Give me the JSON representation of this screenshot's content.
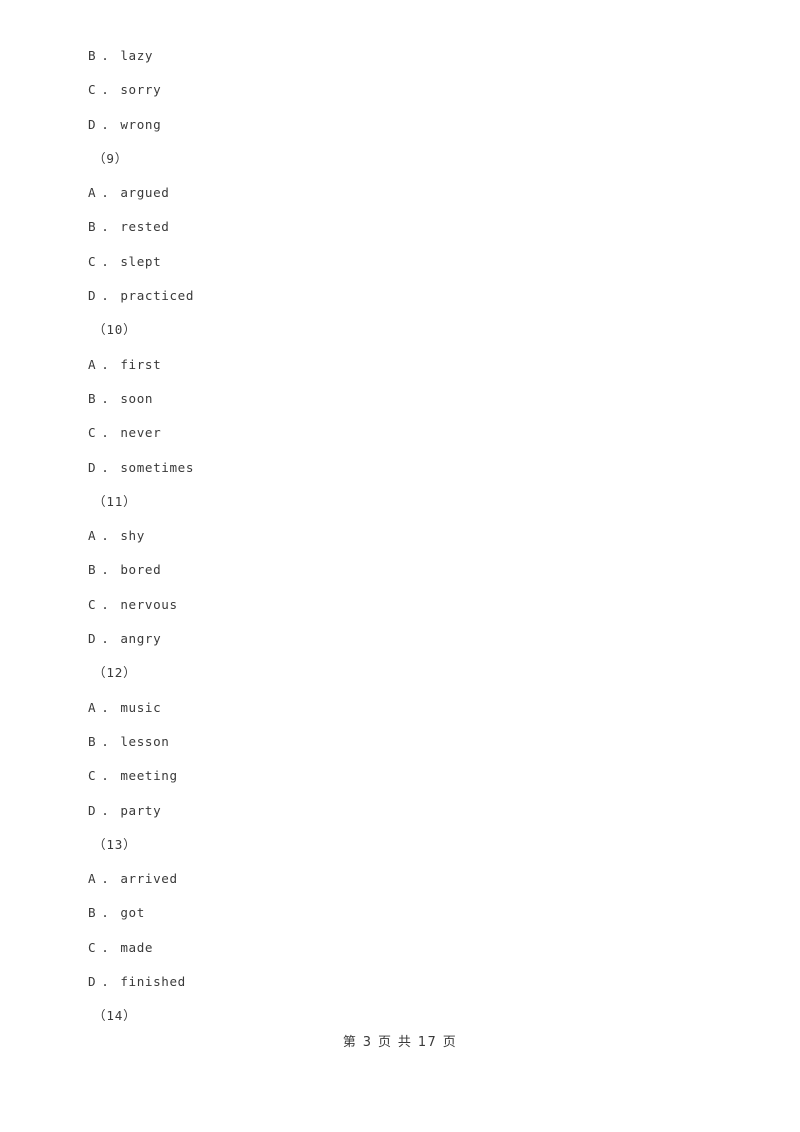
{
  "document": {
    "footer": {
      "page_label": "第 3 页 共 17 页"
    },
    "lines": [
      {
        "kind": "option",
        "label": "B",
        "sep": ".",
        "text": "lazy"
      },
      {
        "kind": "option",
        "label": "C",
        "sep": ".",
        "text": "sorry"
      },
      {
        "kind": "option",
        "label": "D",
        "sep": ".",
        "text": "wrong"
      },
      {
        "kind": "qnum",
        "text": "（9）"
      },
      {
        "kind": "option",
        "label": "A",
        "sep": ".",
        "text": "argued"
      },
      {
        "kind": "option",
        "label": "B",
        "sep": ".",
        "text": "rested"
      },
      {
        "kind": "option",
        "label": "C",
        "sep": ".",
        "text": "slept"
      },
      {
        "kind": "option",
        "label": "D",
        "sep": ".",
        "text": "practiced"
      },
      {
        "kind": "qnum",
        "text": "（10）"
      },
      {
        "kind": "option",
        "label": "A",
        "sep": ".",
        "text": "first"
      },
      {
        "kind": "option",
        "label": "B",
        "sep": ".",
        "text": "soon"
      },
      {
        "kind": "option",
        "label": "C",
        "sep": ".",
        "text": "never"
      },
      {
        "kind": "option",
        "label": "D",
        "sep": ".",
        "text": "sometimes"
      },
      {
        "kind": "qnum",
        "text": "（11）"
      },
      {
        "kind": "option",
        "label": "A",
        "sep": ".",
        "text": "shy"
      },
      {
        "kind": "option",
        "label": "B",
        "sep": ".",
        "text": "bored"
      },
      {
        "kind": "option",
        "label": "C",
        "sep": ".",
        "text": "nervous"
      },
      {
        "kind": "option",
        "label": "D",
        "sep": ".",
        "text": "angry"
      },
      {
        "kind": "qnum",
        "text": "（12）"
      },
      {
        "kind": "option",
        "label": "A",
        "sep": ".",
        "text": "music"
      },
      {
        "kind": "option",
        "label": "B",
        "sep": ".",
        "text": "lesson"
      },
      {
        "kind": "option",
        "label": "C",
        "sep": ".",
        "text": "meeting"
      },
      {
        "kind": "option",
        "label": "D",
        "sep": ".",
        "text": "party"
      },
      {
        "kind": "qnum",
        "text": "（13）"
      },
      {
        "kind": "option",
        "label": "A",
        "sep": ".",
        "text": "arrived"
      },
      {
        "kind": "option",
        "label": "B",
        "sep": ".",
        "text": "got"
      },
      {
        "kind": "option",
        "label": "C",
        "sep": ".",
        "text": "made"
      },
      {
        "kind": "option",
        "label": "D",
        "sep": ".",
        "text": "finished"
      },
      {
        "kind": "qnum",
        "text": "（14）"
      }
    ]
  }
}
